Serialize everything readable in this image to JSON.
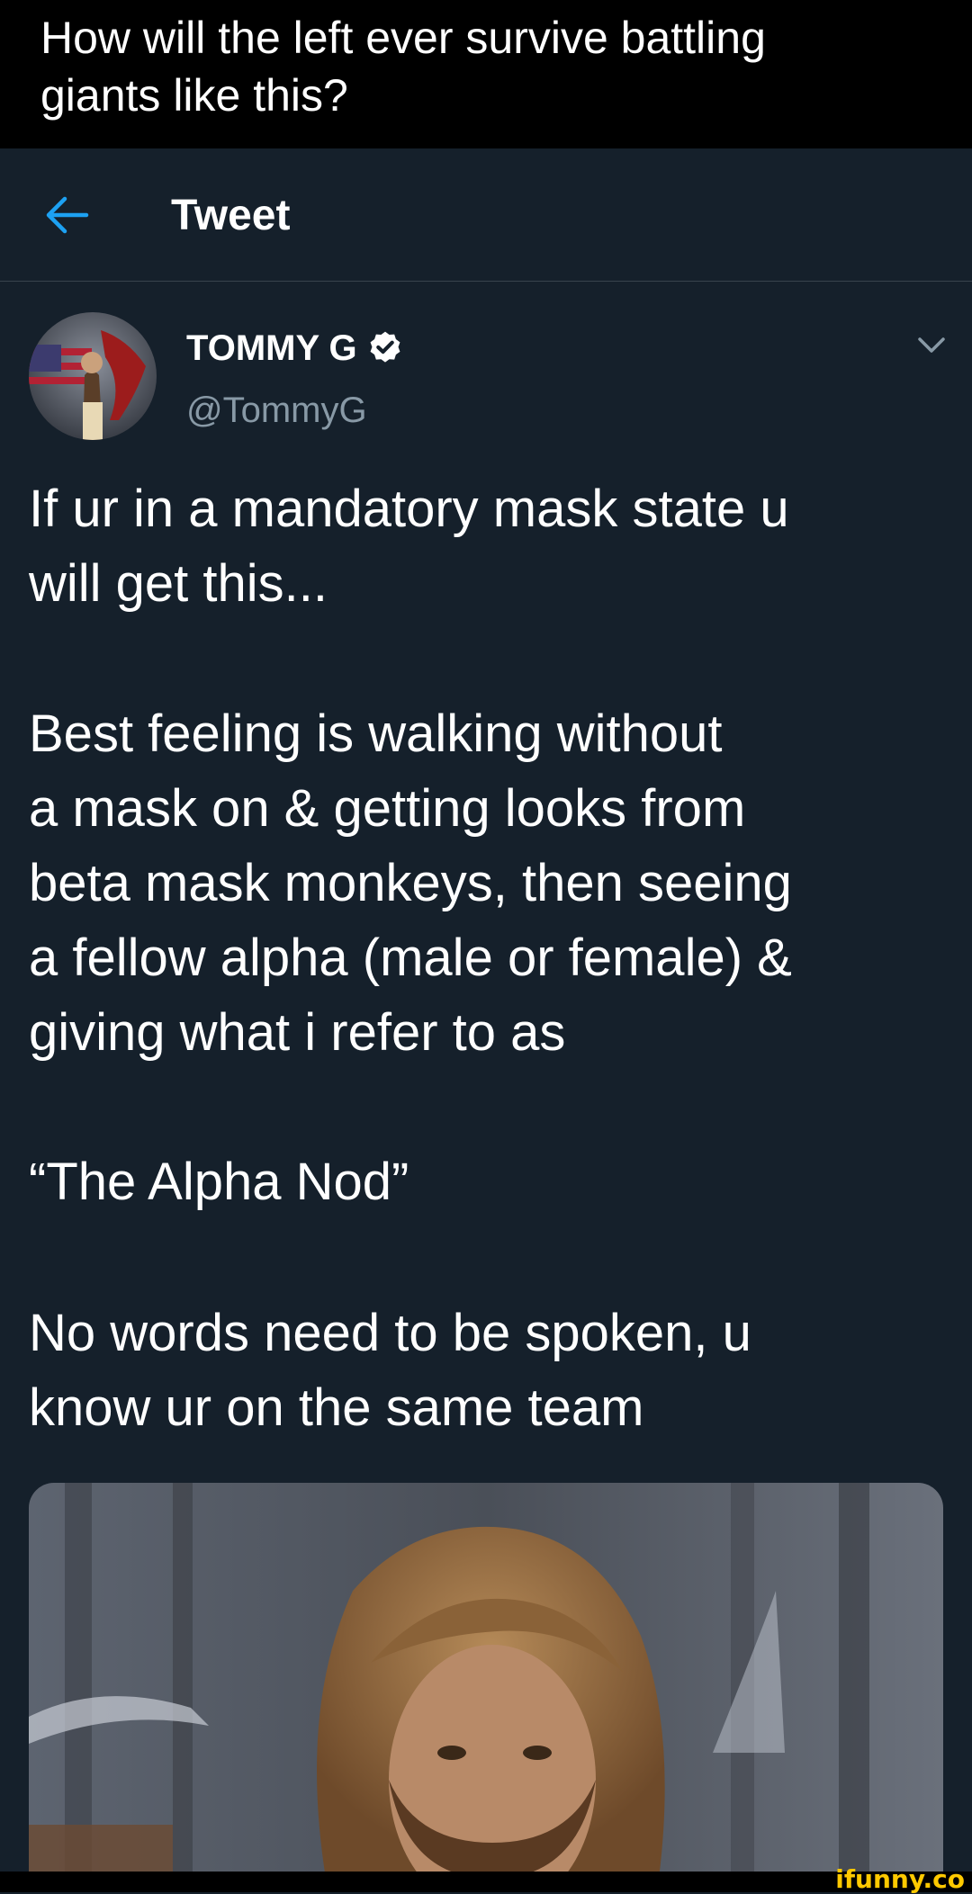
{
  "caption": {
    "line1": "How will the left ever survive battling",
    "line2": "giants like this?"
  },
  "header": {
    "back_icon": "arrow-left-icon",
    "title": "Tweet"
  },
  "author": {
    "display_name": "TOMMY G",
    "verified_icon": "verified-badge-icon",
    "handle": "@TommyG"
  },
  "tweet": {
    "lines": [
      "If ur in a mandatory mask state u",
      "will get this...",
      "Best feeling is walking without",
      "a mask on & getting looks from",
      "beta mask monkeys, then seeing",
      "a fellow alpha (male or female) &",
      "giving what i refer to as",
      "“The Alpha Nod”",
      "No words need to be spoken, u",
      "know ur on the same team"
    ]
  },
  "watermark": "ifunny.co",
  "colors": {
    "background": "#15202b",
    "accent": "#1da1f2",
    "secondary_text": "#8899a6",
    "watermark": "#ffc900"
  }
}
